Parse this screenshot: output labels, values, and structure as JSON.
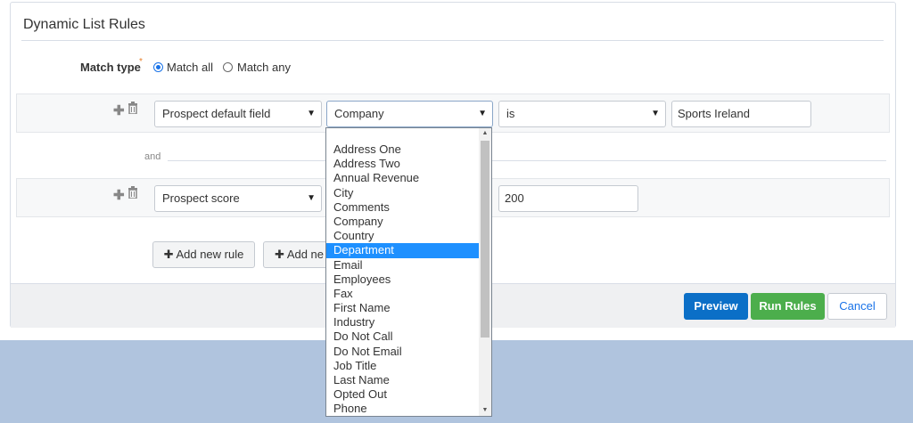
{
  "panel": {
    "title": "Dynamic List Rules"
  },
  "match": {
    "label": "Match type",
    "required_mark": "*",
    "options": [
      "Match all",
      "Match any"
    ],
    "selected": "Match all"
  },
  "rules": [
    {
      "field_type": "Prospect default field",
      "field": "Company",
      "operator": "is",
      "value": "Sports Ireland"
    },
    {
      "field_type": "Prospect score",
      "value": "200"
    }
  ],
  "conjunction": "and",
  "buttons": {
    "add_rule": "Add new rule",
    "add_group": "Add ne",
    "preview": "Preview",
    "run": "Run Rules",
    "cancel": "Cancel"
  },
  "dropdown": {
    "options": [
      "Address One",
      "Address Two",
      "Annual Revenue",
      "City",
      "Comments",
      "Company",
      "Country",
      "Department",
      "Email",
      "Employees",
      "Fax",
      "First Name",
      "Industry",
      "Do Not Call",
      "Do Not Email",
      "Job Title",
      "Last Name",
      "Opted Out",
      "Phone"
    ],
    "highlighted": "Department"
  },
  "icons": {
    "plus": "plus-icon",
    "trash": "trash-icon",
    "caret": "chevron-down-icon"
  },
  "colors": {
    "primary": "#0b6fc7",
    "success": "#4cae4c",
    "highlight": "#1e90ff",
    "required": "#e8812d"
  }
}
